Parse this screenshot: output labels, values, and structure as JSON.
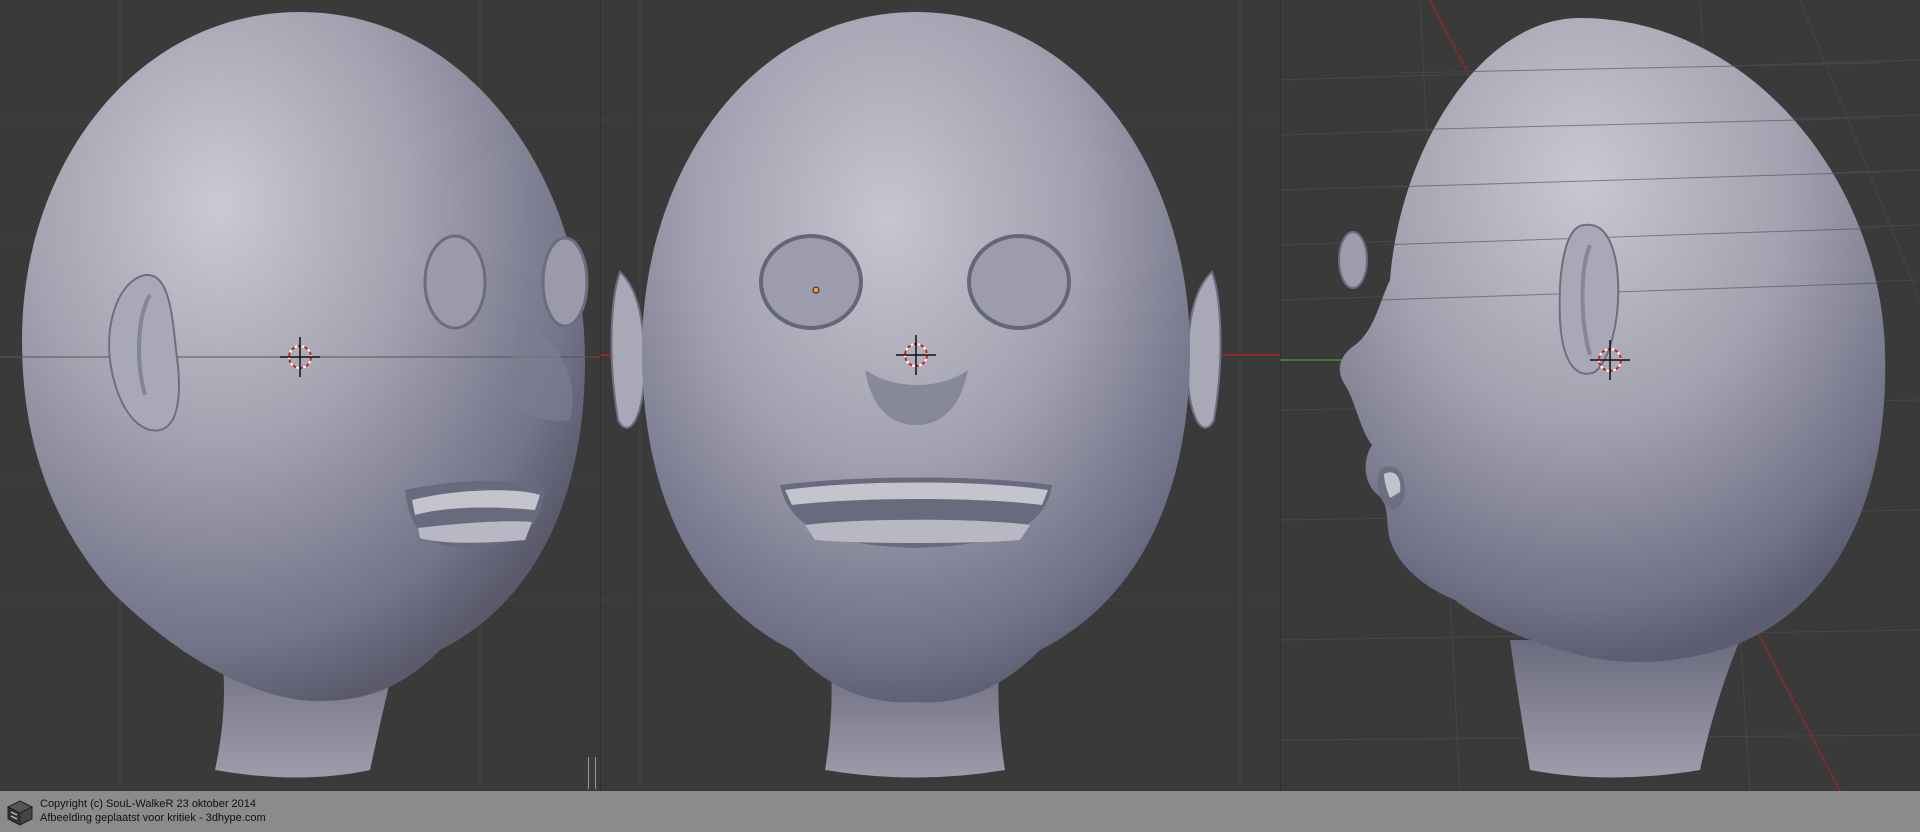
{
  "app": {
    "name": "Blender 3D viewport"
  },
  "viewports": [
    {
      "id": "left",
      "view": "three-quarter"
    },
    {
      "id": "center",
      "view": "front"
    },
    {
      "id": "right",
      "view": "side"
    }
  ],
  "colors": {
    "background": "#3a3a3a",
    "grid_line": "#474747",
    "mesh": "#9a9aa8",
    "mesh_highlight": "#c9c9d2",
    "mesh_shadow": "#5d5d6c",
    "x_axis": "#8a2a2a",
    "y_axis": "#3d7a2e",
    "origin_dot": "#f0a030",
    "footer_bg": "#8b8b8b"
  },
  "icons": {
    "logo": "cube-logo-icon",
    "cursor": "3d-cursor-icon"
  },
  "footer": {
    "line1": "Copyright (c) SouL-WalkeR 23 oktober 2014",
    "line2": "Afbeelding geplaatst voor kritiek - 3dhype.com"
  }
}
